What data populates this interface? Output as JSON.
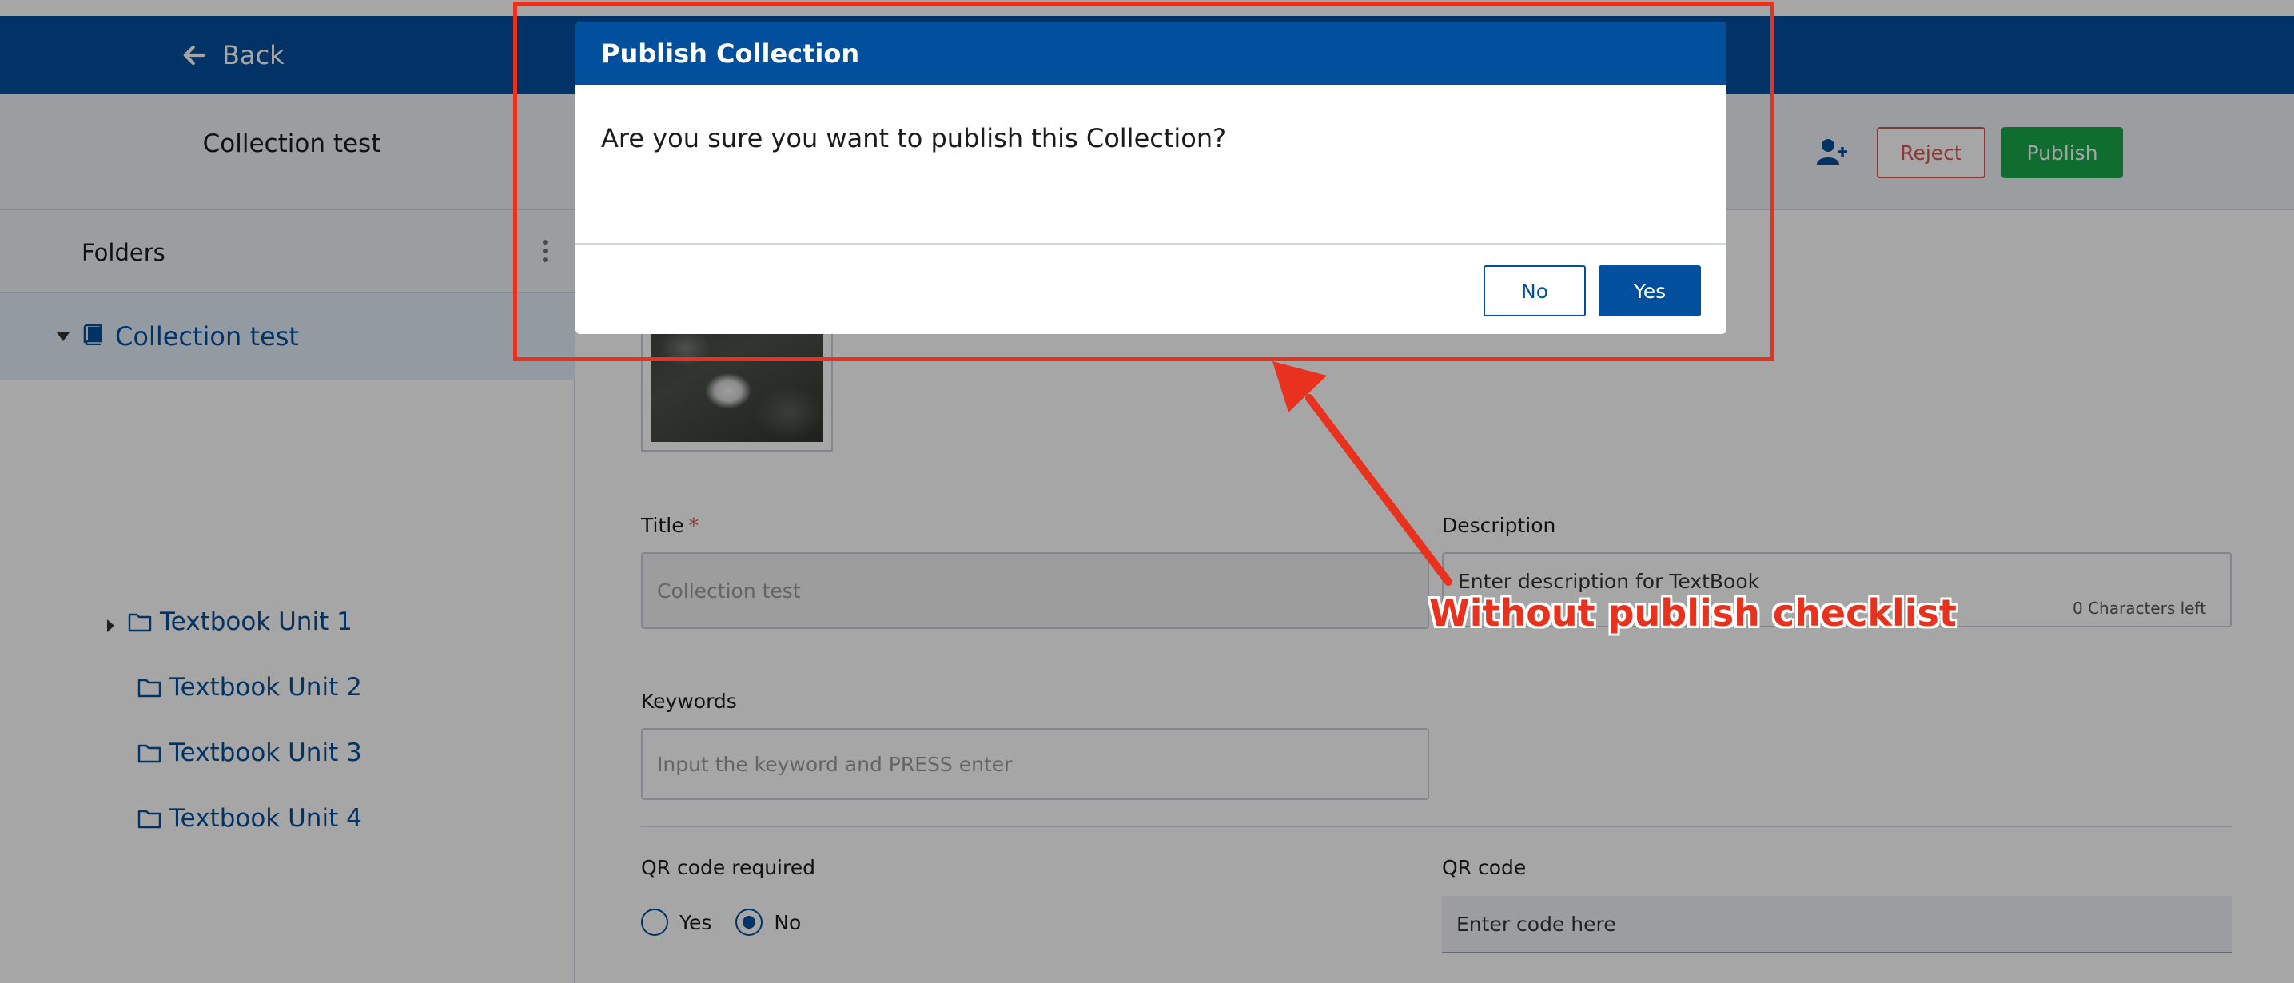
{
  "topbar": {
    "back_label": "Back"
  },
  "header": {
    "title": "Collection test",
    "reject_label": "Reject",
    "publish_label": "Publish"
  },
  "sidebar": {
    "folders_title": "Folders",
    "root": "Collection test",
    "items": [
      {
        "label": "Textbook Unit 1"
      },
      {
        "label": "Textbook Unit 2"
      },
      {
        "label": "Textbook Unit 3"
      },
      {
        "label": "Textbook Unit 4"
      }
    ]
  },
  "form": {
    "title_label": "Title",
    "title_required_mark": "*",
    "title_placeholder": "Collection test",
    "description_label": "Description",
    "description_placeholder": "Enter description for TextBook",
    "description_chars_left": "0 Characters left",
    "keywords_label": "Keywords",
    "keywords_placeholder": "Input the keyword and PRESS enter",
    "qr_required_label": "QR code required",
    "qr_yes": "Yes",
    "qr_no": "No",
    "qr_required_value": "No",
    "qr_code_label": "QR code",
    "qr_code_placeholder": "Enter code here"
  },
  "modal": {
    "title": "Publish Collection",
    "message": "Are you sure you want to publish this Collection?",
    "no_label": "No",
    "yes_label": "Yes"
  },
  "annotation": {
    "text": "Without publish checklist"
  },
  "colors": {
    "brand": "#024f9d",
    "publish": "#18a84b",
    "reject": "#d9534f",
    "annotation": "#e8321e"
  }
}
